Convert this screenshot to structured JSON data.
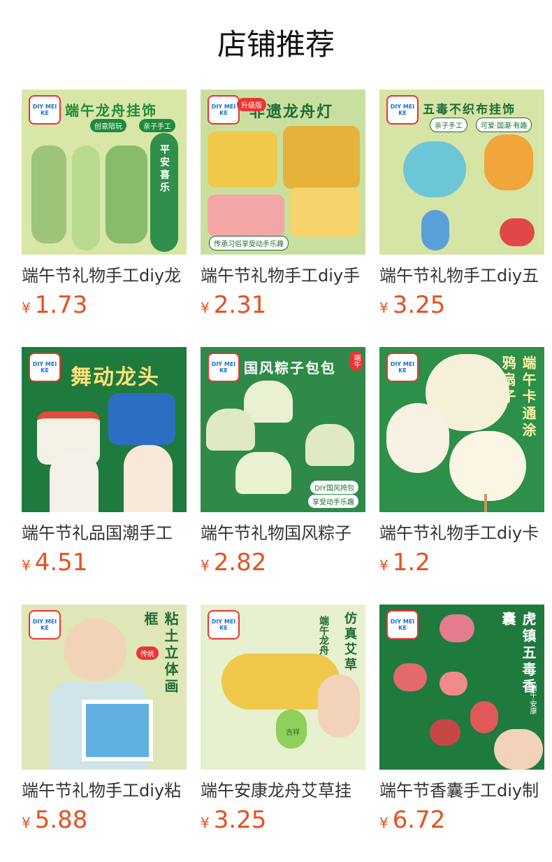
{
  "page": {
    "title": "店铺推荐"
  },
  "products": [
    {
      "name": "端午节礼物手工diy龙",
      "currency": "¥",
      "price": "1.73",
      "image": {
        "headline": "端午龙舟挂饰",
        "tags": [
          "创意陪玩",
          "亲子手工"
        ],
        "bg": "#d8e6a8",
        "accent": "#1f8a3b",
        "vertical": "平安喜乐"
      }
    },
    {
      "name": "端午节礼物手工diy手",
      "currency": "¥",
      "price": "2.31",
      "image": {
        "headline": "非遗龙舟灯",
        "tags": [
          "升级版",
          "传承习俗享受动手乐趣"
        ],
        "bg": "#c9dfa0",
        "accent": "#1f6b34"
      }
    },
    {
      "name": "端午节礼物手工diy五",
      "currency": "¥",
      "price": "3.25",
      "image": {
        "headline": "五毒不织布挂饰",
        "tags": [
          "亲子手工",
          "可爱·国潮·有趣"
        ],
        "bg": "#d6e4a6",
        "accent": "#1f6b34"
      }
    },
    {
      "name": "端午节礼品国潮手工",
      "currency": "¥",
      "price": "4.51",
      "image": {
        "headline": "舞动龙头",
        "tags": [],
        "bg": "#1f7a3e",
        "accent": "#ffe27a"
      }
    },
    {
      "name": "端午节礼物国风粽子",
      "currency": "¥",
      "price": "2.82",
      "image": {
        "headline": "国风粽子包包",
        "tags": [
          "端午",
          "DIY国风挎包",
          "享受动手乐趣"
        ],
        "bg": "#2f8a4a",
        "accent": "#ffffff"
      }
    },
    {
      "name": "端午节礼物手工diy卡",
      "currency": "¥",
      "price": "1.2",
      "image": {
        "headline": "",
        "tags": [],
        "bg": "#2c8f4a",
        "accent": "#fff1a8",
        "vertical": "端午卡通涂鸦扇子"
      }
    },
    {
      "name": "端午节礼物手工diy粘",
      "currency": "¥",
      "price": "5.88",
      "image": {
        "headline": "",
        "tags": [
          "传统"
        ],
        "bg": "#dfe6b8",
        "accent": "#1f6b34",
        "vertical": "粘土立体画框"
      }
    },
    {
      "name": "端午安康龙舟艾草挂",
      "currency": "¥",
      "price": "3.25",
      "image": {
        "headline": "",
        "tags": [
          "端午龙舟",
          "吉祥"
        ],
        "bg": "#e7f0cf",
        "accent": "#1f6b34",
        "vertical": "仿真艾草"
      }
    },
    {
      "name": "端午节香囊手工diy制",
      "currency": "¥",
      "price": "6.72",
      "image": {
        "headline": "",
        "tags": [
          "端午·安康"
        ],
        "bg": "#1f7a3e",
        "accent": "#ffffff",
        "vertical": "虎镇五毒香囊"
      }
    }
  ],
  "brand_logo": "DIY MEI KE"
}
